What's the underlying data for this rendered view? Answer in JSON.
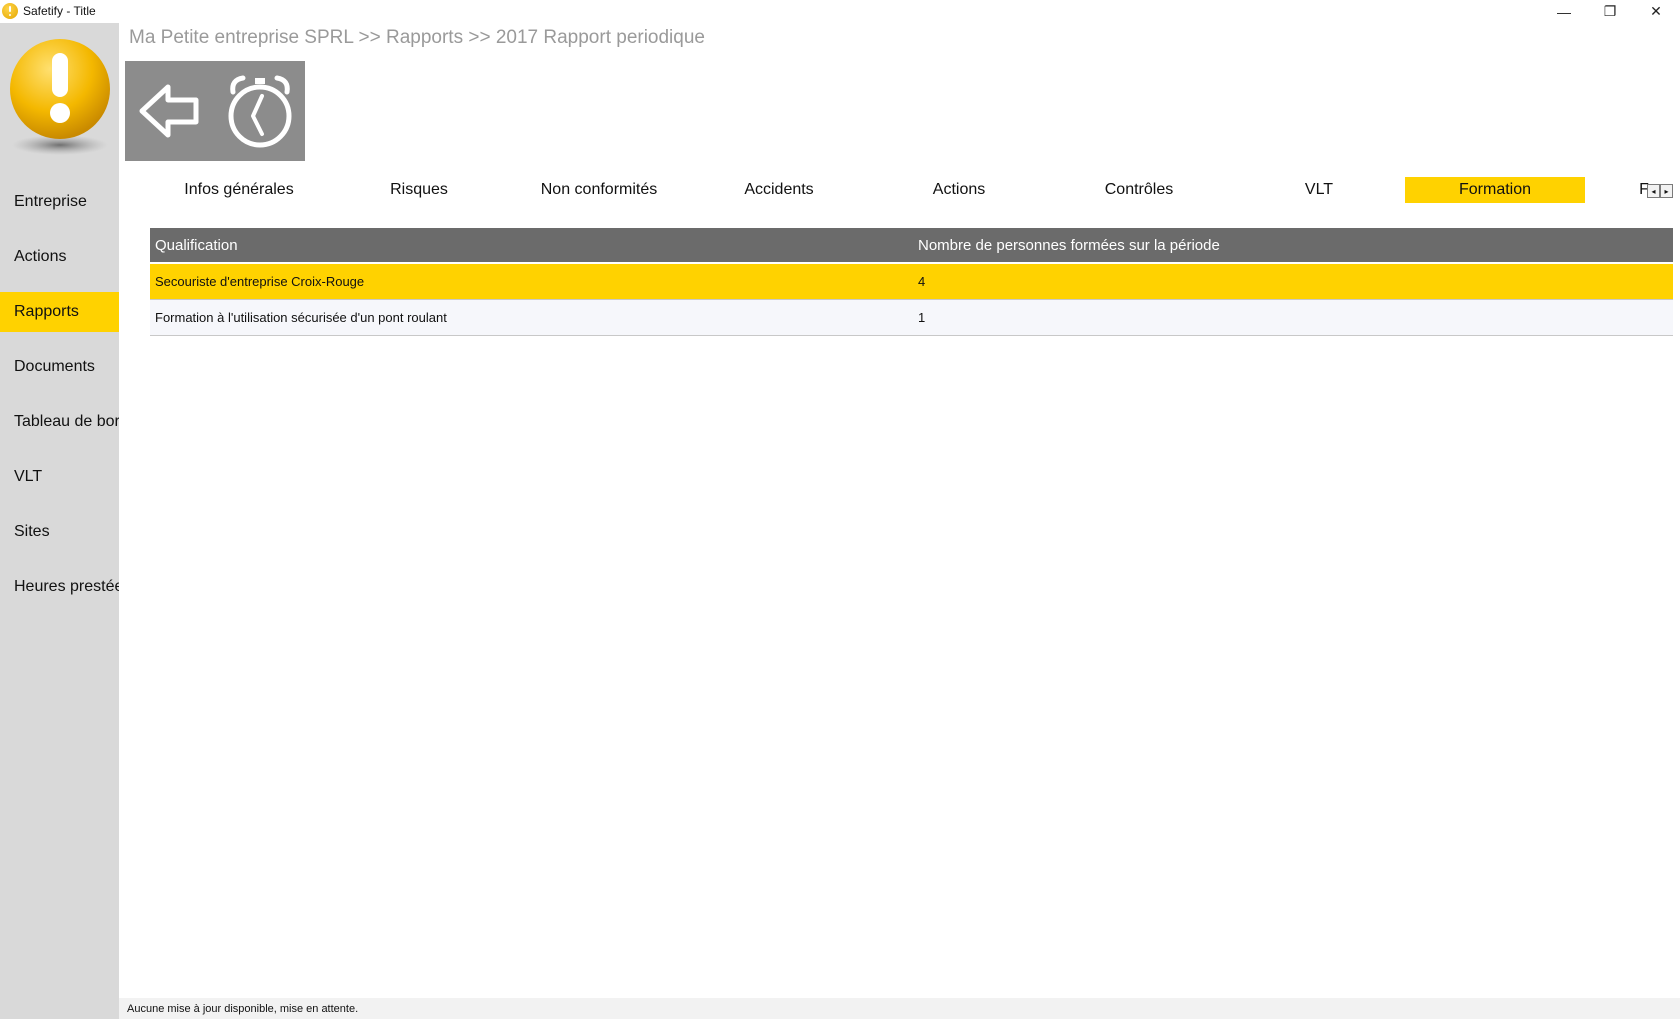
{
  "window": {
    "title": "Safetify - Title",
    "minimize_glyph": "—",
    "maximize_glyph": "❐",
    "close_glyph": "✕"
  },
  "sidebar": {
    "items": [
      {
        "label": "Entreprise",
        "active": false
      },
      {
        "label": "Actions",
        "active": false
      },
      {
        "label": "Rapports",
        "active": true
      },
      {
        "label": "Documents",
        "active": false
      },
      {
        "label": "Tableau de bord",
        "active": false
      },
      {
        "label": "VLT",
        "active": false
      },
      {
        "label": "Sites",
        "active": false
      },
      {
        "label": "Heures prestées",
        "active": false
      }
    ]
  },
  "breadcrumb": "Ma Petite entreprise SPRL >> Rapports >> 2017 Rapport periodique",
  "toolbar": {
    "back_icon": "back-arrow-icon",
    "clock_icon": "alarm-clock-icon"
  },
  "tabs": [
    {
      "label": "Infos générales",
      "active": false
    },
    {
      "label": "Risques",
      "active": false
    },
    {
      "label": "Non conformités",
      "active": false
    },
    {
      "label": "Accidents",
      "active": false
    },
    {
      "label": "Actions",
      "active": false
    },
    {
      "label": "Contrôles",
      "active": false
    },
    {
      "label": "VLT",
      "active": false
    },
    {
      "label": "Formation",
      "active": true
    },
    {
      "label": "F",
      "active": false
    }
  ],
  "tab_scroll": {
    "left": "◂",
    "right": "▸"
  },
  "grid": {
    "columns": [
      "Qualification",
      "Nombre de personnes formées sur la période"
    ],
    "rows": [
      {
        "qualification": "Secouriste d'entreprise Croix-Rouge",
        "count": "4",
        "selected": true
      },
      {
        "qualification": "Formation à l'utilisation sécurisée d'un pont roulant",
        "count": "1",
        "selected": false
      }
    ]
  },
  "status": "Aucune mise à jour disponible, mise en attente.",
  "colors": {
    "accent": "#ffd200",
    "sidebar_bg": "#d9d9d9",
    "toolbar_bg": "#8c8c8c",
    "header_bg": "#6b6b6b",
    "breadcrumb": "#9a9a9a"
  }
}
